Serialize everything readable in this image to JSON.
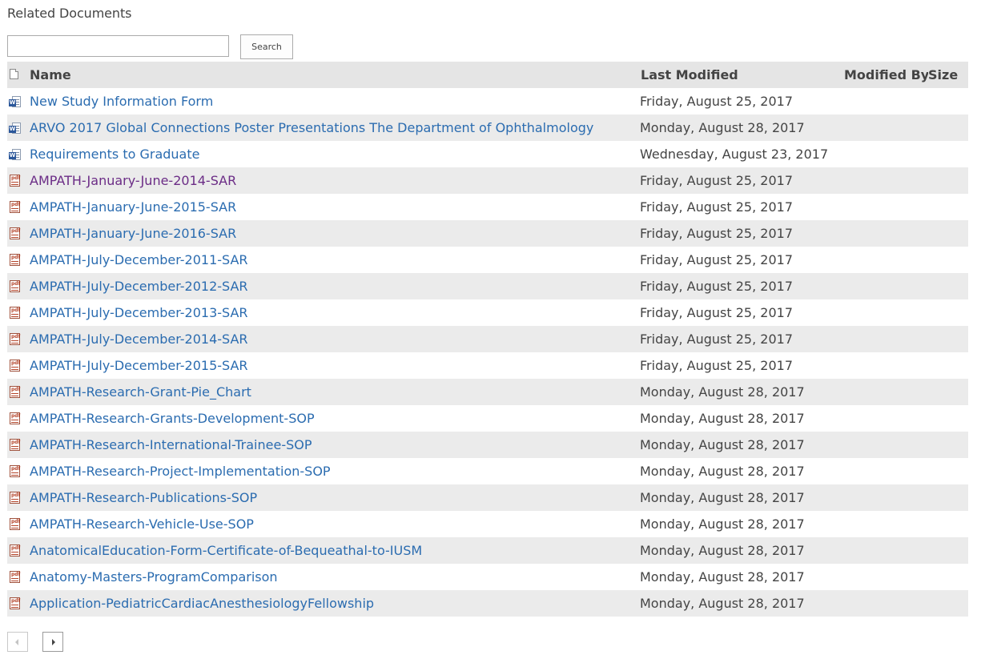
{
  "page": {
    "title": "Related Documents"
  },
  "search": {
    "value": "",
    "placeholder": "",
    "button_label": "Search"
  },
  "table": {
    "columns": {
      "name": "Name",
      "last_modified": "Last Modified",
      "modified_by": "Modified By",
      "size": "Size"
    },
    "rows": [
      {
        "type": "word",
        "name": "New Study Information Form",
        "last_modified": "Friday, August 25, 2017",
        "modified_by": "",
        "size": "",
        "visited": false
      },
      {
        "type": "word",
        "name": "ARVO 2017 Global Connections Poster Presentations The Department of Ophthalmology",
        "last_modified": "Monday, August 28, 2017",
        "modified_by": "",
        "size": "",
        "visited": false
      },
      {
        "type": "word",
        "name": "Requirements to Graduate",
        "last_modified": "Wednesday, August 23, 2017",
        "modified_by": "",
        "size": "",
        "visited": false
      },
      {
        "type": "pdf",
        "name": "AMPATH-January-June-2014-SAR",
        "last_modified": "Friday, August 25, 2017",
        "modified_by": "",
        "size": "",
        "visited": true
      },
      {
        "type": "pdf",
        "name": "AMPATH-January-June-2015-SAR",
        "last_modified": "Friday, August 25, 2017",
        "modified_by": "",
        "size": "",
        "visited": false
      },
      {
        "type": "pdf",
        "name": "AMPATH-January-June-2016-SAR",
        "last_modified": "Friday, August 25, 2017",
        "modified_by": "",
        "size": "",
        "visited": false
      },
      {
        "type": "pdf",
        "name": "AMPATH-July-December-2011-SAR",
        "last_modified": "Friday, August 25, 2017",
        "modified_by": "",
        "size": "",
        "visited": false
      },
      {
        "type": "pdf",
        "name": "AMPATH-July-December-2012-SAR",
        "last_modified": "Friday, August 25, 2017",
        "modified_by": "",
        "size": "",
        "visited": false
      },
      {
        "type": "pdf",
        "name": "AMPATH-July-December-2013-SAR",
        "last_modified": "Friday, August 25, 2017",
        "modified_by": "",
        "size": "",
        "visited": false
      },
      {
        "type": "pdf",
        "name": "AMPATH-July-December-2014-SAR",
        "last_modified": "Friday, August 25, 2017",
        "modified_by": "",
        "size": "",
        "visited": false
      },
      {
        "type": "pdf",
        "name": "AMPATH-July-December-2015-SAR",
        "last_modified": "Friday, August 25, 2017",
        "modified_by": "",
        "size": "",
        "visited": false
      },
      {
        "type": "pdf",
        "name": "AMPATH-Research-Grant-Pie_Chart",
        "last_modified": "Monday, August 28, 2017",
        "modified_by": "",
        "size": "",
        "visited": false
      },
      {
        "type": "pdf",
        "name": "AMPATH-Research-Grants-Development-SOP",
        "last_modified": "Monday, August 28, 2017",
        "modified_by": "",
        "size": "",
        "visited": false
      },
      {
        "type": "pdf",
        "name": "AMPATH-Research-International-Trainee-SOP",
        "last_modified": "Monday, August 28, 2017",
        "modified_by": "",
        "size": "",
        "visited": false
      },
      {
        "type": "pdf",
        "name": "AMPATH-Research-Project-Implementation-SOP",
        "last_modified": "Monday, August 28, 2017",
        "modified_by": "",
        "size": "",
        "visited": false
      },
      {
        "type": "pdf",
        "name": "AMPATH-Research-Publications-SOP",
        "last_modified": "Monday, August 28, 2017",
        "modified_by": "",
        "size": "",
        "visited": false
      },
      {
        "type": "pdf",
        "name": "AMPATH-Research-Vehicle-Use-SOP",
        "last_modified": "Monday, August 28, 2017",
        "modified_by": "",
        "size": "",
        "visited": false
      },
      {
        "type": "pdf",
        "name": "AnatomicalEducation-Form-Certificate-of-Bequeathal-to-IUSM",
        "last_modified": "Monday, August 28, 2017",
        "modified_by": "",
        "size": "",
        "visited": false
      },
      {
        "type": "pdf",
        "name": "Anatomy-Masters-ProgramComparison",
        "last_modified": "Monday, August 28, 2017",
        "modified_by": "",
        "size": "",
        "visited": false
      },
      {
        "type": "pdf",
        "name": "Application-PediatricCardiacAnesthesiologyFellowship",
        "last_modified": "Monday, August 28, 2017",
        "modified_by": "",
        "size": "",
        "visited": false
      }
    ]
  },
  "pagination": {
    "prev_icon": "chevron-left-icon",
    "next_icon": "chevron-right-icon"
  },
  "colors": {
    "link": "#2b6cb0",
    "visited_link": "#6b2c86",
    "header_bg": "#e5e5e5",
    "alt_row_bg": "#ebebeb",
    "text": "#444444"
  }
}
